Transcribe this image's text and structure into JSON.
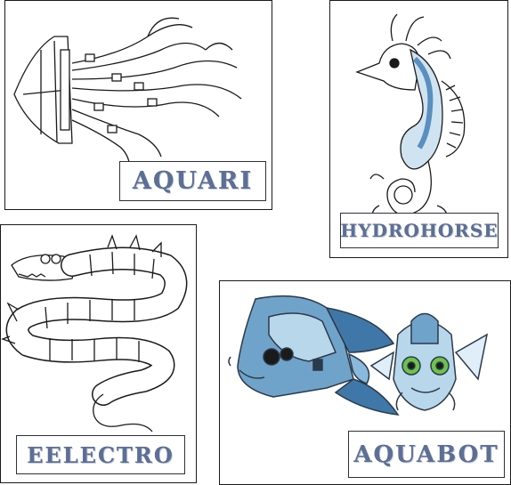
{
  "cards": [
    {
      "label": "AQUARI"
    },
    {
      "label": "HYDROHORSE"
    },
    {
      "label": "EELECTRO"
    },
    {
      "label": "AQUABOT"
    }
  ],
  "colors": {
    "label_text": "#5d6f95",
    "line_art": "#1a1a1a",
    "fish_blue": "#6fa3c9",
    "fish_light": "#b9d7ea",
    "eye_green": "#6cc24a"
  }
}
